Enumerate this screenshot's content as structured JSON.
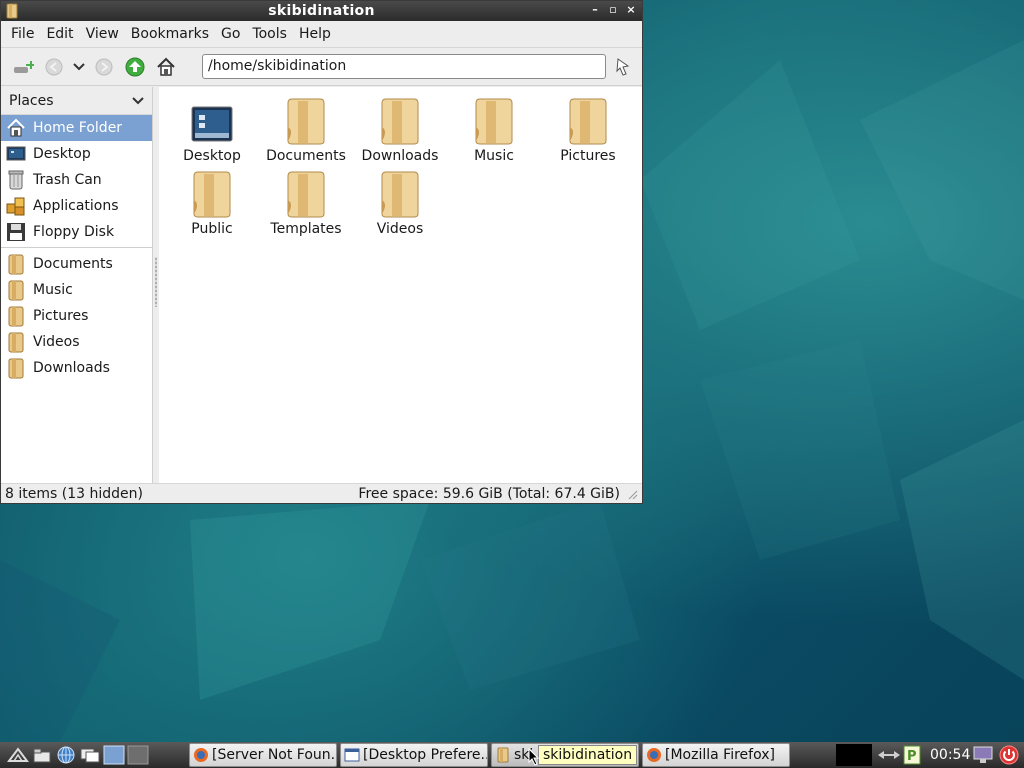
{
  "window": {
    "title": "skibidination",
    "controls": [
      "minimize-icon",
      "maximize-icon",
      "close-icon"
    ]
  },
  "menubar": {
    "items": [
      "File",
      "Edit",
      "View",
      "Bookmarks",
      "Go",
      "Tools",
      "Help"
    ]
  },
  "toolbar": {
    "path": "/home/skibidination"
  },
  "sidebar": {
    "header": "Places",
    "items": [
      {
        "label": "Home Folder",
        "icon": "home-icon"
      },
      {
        "label": "Desktop",
        "icon": "desktop-icon"
      },
      {
        "label": "Trash Can",
        "icon": "trash-icon"
      },
      {
        "label": "Applications",
        "icon": "applications-icon"
      },
      {
        "label": "Floppy Disk",
        "icon": "floppy-icon"
      }
    ],
    "bookmarks": [
      {
        "label": "Documents",
        "icon": "folder-icon"
      },
      {
        "label": "Music",
        "icon": "folder-icon"
      },
      {
        "label": "Pictures",
        "icon": "folder-icon"
      },
      {
        "label": "Videos",
        "icon": "folder-icon"
      },
      {
        "label": "Downloads",
        "icon": "folder-icon"
      }
    ]
  },
  "files": [
    {
      "name": "Desktop",
      "icon": "desktop-icon"
    },
    {
      "name": "Documents",
      "icon": "folder-icon"
    },
    {
      "name": "Downloads",
      "icon": "folder-icon"
    },
    {
      "name": "Music",
      "icon": "folder-icon"
    },
    {
      "name": "Pictures",
      "icon": "folder-icon"
    },
    {
      "name": "Public",
      "icon": "folder-icon"
    },
    {
      "name": "Templates",
      "icon": "folder-icon"
    },
    {
      "name": "Videos",
      "icon": "folder-icon"
    }
  ],
  "status": {
    "left": "8 items (13 hidden)",
    "right": "Free space: 59.6 GiB (Total: 67.4 GiB)"
  },
  "taskbar": {
    "tasks": [
      {
        "label": "[Server Not Foun...",
        "icon": "firefox-icon"
      },
      {
        "label": "[Desktop Prefere...",
        "icon": "window-icon"
      },
      {
        "label": "ski",
        "icon": "folder-icon"
      },
      {
        "label": "[Mozilla Firefox]",
        "icon": "firefox-icon"
      }
    ],
    "tooltip": "skibidination",
    "clock": "00:54"
  },
  "colors": {
    "selection": "#7aa1d2",
    "desktop": "#0f5d6d",
    "folder": "#e9c98a"
  }
}
